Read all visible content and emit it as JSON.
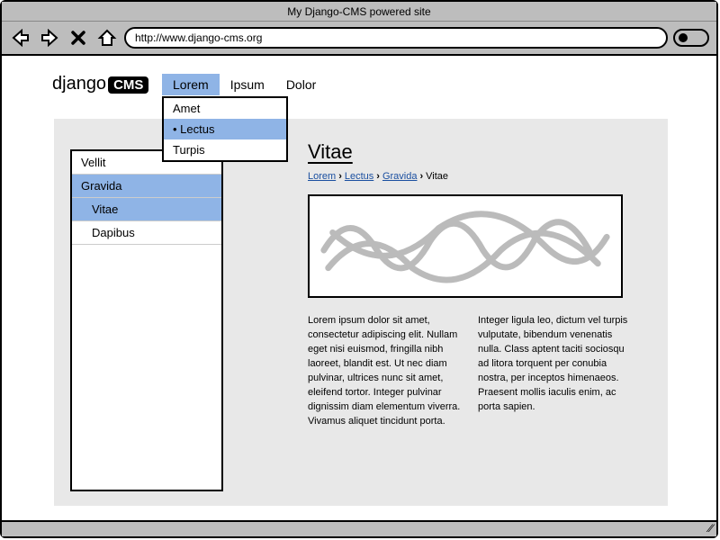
{
  "browser": {
    "title": "My Django-CMS powered site",
    "url": "http://www.django-cms.org"
  },
  "logo": {
    "text": "django",
    "badge": "CMS"
  },
  "topnav": {
    "items": [
      {
        "label": "Lorem",
        "active": true
      },
      {
        "label": "Ipsum",
        "active": false
      },
      {
        "label": "Dolor",
        "active": false
      }
    ]
  },
  "dropdown": {
    "items": [
      {
        "label": "Amet",
        "selected": false
      },
      {
        "label": "Lectus",
        "selected": true
      },
      {
        "label": "Turpis",
        "selected": false
      }
    ]
  },
  "sidebar": {
    "items": [
      {
        "label": "Vellit",
        "level": 0,
        "selected": false
      },
      {
        "label": "Gravida",
        "level": 0,
        "selected": true
      },
      {
        "label": "Vitae",
        "level": 1,
        "selected": true
      },
      {
        "label": "Dapibus",
        "level": 1,
        "selected": false
      }
    ]
  },
  "page": {
    "title": "Vitae",
    "breadcrumbs": [
      {
        "label": "Lorem",
        "link": true
      },
      {
        "label": "Lectus",
        "link": true
      },
      {
        "label": "Gravida",
        "link": true
      },
      {
        "label": "Vitae",
        "link": false
      }
    ],
    "body": "Lorem ipsum dolor sit amet, consectetur adipiscing elit. Nullam eget nisi euismod, fringilla nibh laoreet, blandit est. Ut nec diam pulvinar, ultrices nunc sit amet, eleifend tortor. Integer pulvinar dignissim diam elementum viverra. Vivamus aliquet tincidunt porta. Integer ligula leo, dictum vel turpis vulputate, bibendum venenatis nulla. Class aptent taciti sociosqu ad litora torquent per conubia nostra, per inceptos himenaeos. Praesent mollis iaculis enim, ac porta sapien."
  }
}
